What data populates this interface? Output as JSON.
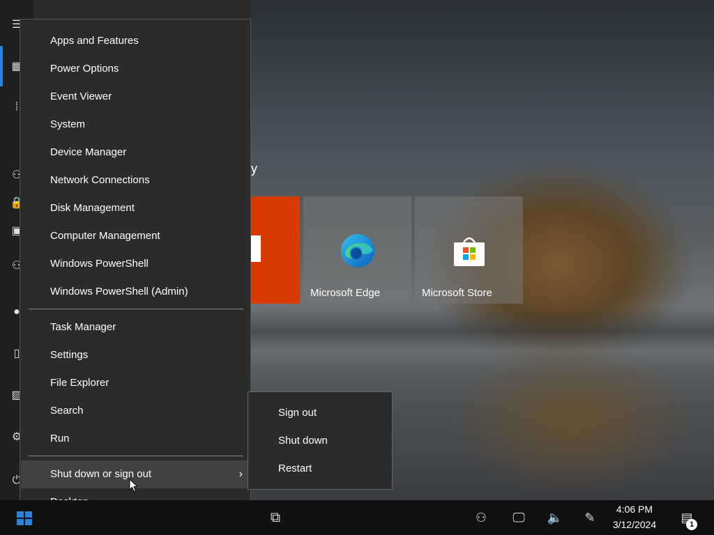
{
  "start_menu": {
    "group_title": "ty",
    "tiles": [
      {
        "label": ""
      },
      {
        "label": "Microsoft Edge",
        "icon": "edge-icon"
      },
      {
        "label": "Microsoft Store",
        "icon": "store-icon"
      }
    ]
  },
  "winx_menu": {
    "items_top": [
      "Apps and Features",
      "Power Options",
      "Event Viewer",
      "System",
      "Device Manager",
      "Network Connections",
      "Disk Management",
      "Computer Management",
      "Windows PowerShell",
      "Windows PowerShell (Admin)"
    ],
    "items_bottom": [
      "Task Manager",
      "Settings",
      "File Explorer",
      "Search",
      "Run"
    ],
    "shutdown_item": "Shut down or sign out",
    "desktop_item": "Desktop"
  },
  "shutdown_submenu": {
    "items": [
      "Sign out",
      "Shut down",
      "Restart"
    ]
  },
  "taskbar": {
    "time": "4:06 PM",
    "date": "3/12/2024",
    "notification_count": "1",
    "accent_color": "#2a82da"
  }
}
